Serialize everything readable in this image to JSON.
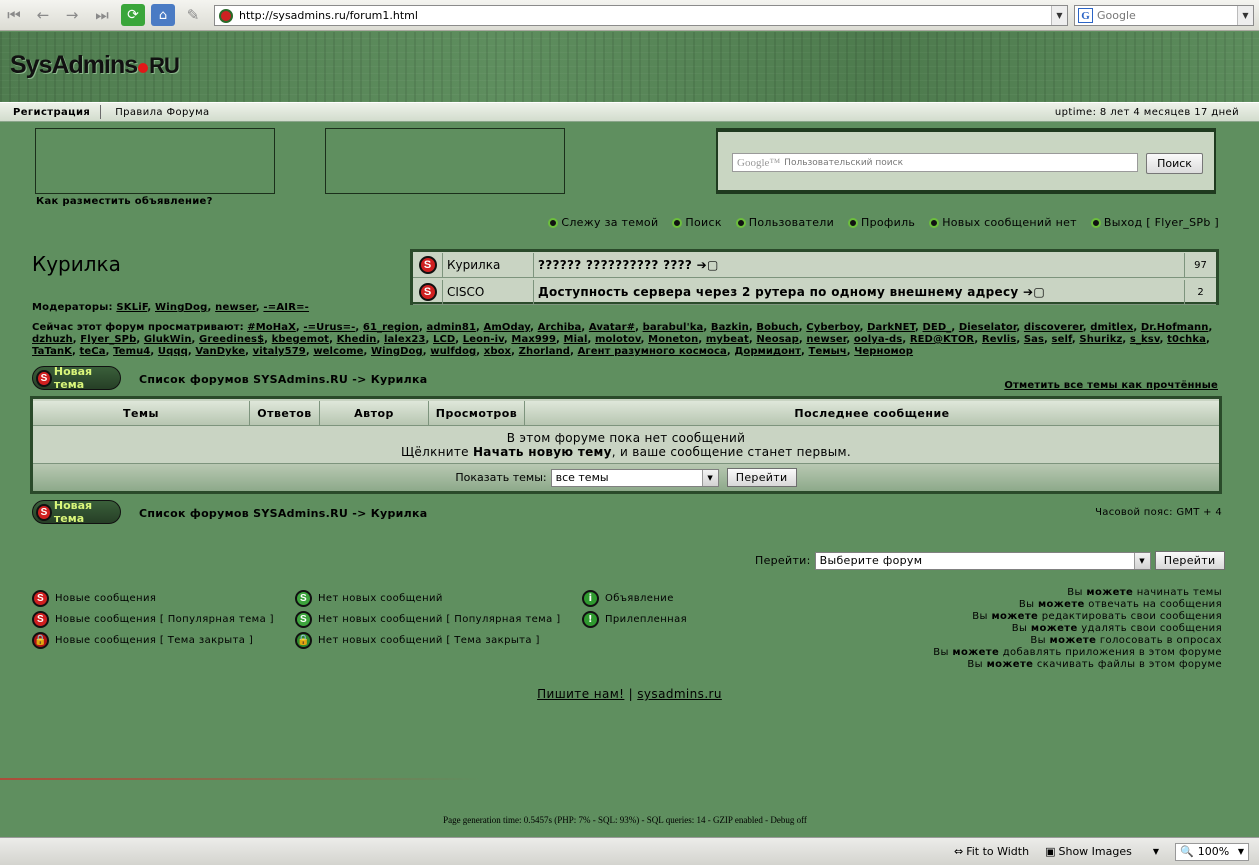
{
  "browser": {
    "url": "http://sysadmins.ru/forum1.html",
    "search_placeholder": "Google",
    "search_engine_letter": "G"
  },
  "header": {
    "logo_main": "SysAdmins",
    "logo_tld": "RU"
  },
  "nav": {
    "registration": "Регистрация",
    "rules": "Правила Форума",
    "uptime": "uptime: 8 лет 4 месяцев 17 дней"
  },
  "ads": {
    "how_to_place": "Как разместить объявление?"
  },
  "gsearch": {
    "brand": "Google™",
    "placeholder": "Пользовательский поиск",
    "button": "Поиск"
  },
  "topmenu": [
    {
      "label": "Слежу за темой"
    },
    {
      "label": "Поиск"
    },
    {
      "label": "Пользователи"
    },
    {
      "label": "Профиль"
    },
    {
      "label": "Новых сообщений нет"
    },
    {
      "label": "Выход [ Flyer_SPb ]"
    }
  ],
  "forum": {
    "title": "Курилка",
    "moderators_label": "Модераторы:",
    "moderators": [
      "SKLiF",
      "WingDog",
      "newser",
      "-=AIR=-"
    ],
    "viewers_label": "Сейчас этот форум просматривают:",
    "viewers": [
      "#MoHaX",
      "-=Urus=-",
      "61_region",
      "admin81",
      "AmOday",
      "Archiba",
      "Avatar#",
      "barabul'ka",
      "Bazkin",
      "Bobuch",
      "Cyberboy",
      "DarkNET",
      "DED_",
      "Dieselator",
      "discoverer",
      "dmitlex",
      "Dr.Hofmann",
      "dzhuzh",
      "Flyer_SPb",
      "GlukWin",
      "Greedines$",
      "kbegemot",
      "Khedin",
      "lalex23",
      "LCD",
      "Leon-iv",
      "Max999",
      "Mial",
      "molotov",
      "Moneton",
      "mybeat",
      "Neosap",
      "newser",
      "oolya-ds",
      "RED@KTOR",
      "Revlis",
      "Sas",
      "self",
      "Shurikz",
      "s_ksv",
      "t0chka",
      "TaTanK",
      "teCa",
      "Temu4",
      "Uqqq",
      "VanDyke",
      "vitaly579",
      "welcome",
      "WingDog",
      "wulfdog",
      "xbox",
      "Zhorland",
      "Агент разумного космоса",
      "Дормидонт",
      "Темыч",
      "Черномор"
    ]
  },
  "recent": [
    {
      "forum": "Курилка",
      "topic": "?????? ?????????? ???? ➔▢",
      "count": "97"
    },
    {
      "forum": "CISCO",
      "topic": "Доступность сервера через 2 рутера по одному внешнему адресу ➔▢",
      "count": "2"
    }
  ],
  "actions": {
    "new_topic": "Новая тема",
    "breadcrumb": "Список форумов SYSAdmins.RU -> Курилка",
    "mark_all": "Отметить все темы как прочтённые",
    "timezone": "Часовой пояс: GMT + 4"
  },
  "topics": {
    "headers": [
      "Темы",
      "Ответов",
      "Автор",
      "Просмотров",
      "Последнее сообщение"
    ],
    "empty_line1": "В этом форуме пока нет сообщений",
    "empty_pre": "Щёлкните ",
    "empty_bold": "Начать новую тему",
    "empty_post": ", и ваше сообщение станет первым.",
    "show_label": "Показать темы:",
    "show_value": "все темы",
    "go_button": "Перейти"
  },
  "jump": {
    "label": "Перейти:",
    "value": "Выберите форум",
    "button": "Перейти"
  },
  "legend": [
    {
      "label": "Новые сообщения"
    },
    {
      "label": "Новые сообщения [ Популярная тема ]"
    },
    {
      "label": "Новые сообщения [ Тема закрыта ]"
    },
    {
      "label": "Нет новых сообщений"
    },
    {
      "label": "Нет новых сообщений [ Популярная тема ]"
    },
    {
      "label": "Нет новых сообщений [ Тема закрыта ]"
    },
    {
      "label": "Объявление"
    },
    {
      "label": "Прилепленная"
    }
  ],
  "permissions": [
    {
      "pre": "Вы ",
      "can": "можете",
      "post": " начинать темы"
    },
    {
      "pre": "Вы ",
      "can": "можете",
      "post": " отвечать на сообщения"
    },
    {
      "pre": "Вы ",
      "can": "можете",
      "post": " редактировать свои сообщения"
    },
    {
      "pre": "Вы ",
      "can": "можете",
      "post": " удалять свои сообщения"
    },
    {
      "pre": "Вы ",
      "can": "можете",
      "post": " голосовать в опросах"
    },
    {
      "pre": "Вы ",
      "can": "можете",
      "post": " добавлять приложения в этом форуме"
    },
    {
      "pre": "Вы ",
      "can": "можете",
      "post": " скачивать файлы в этом форуме"
    }
  ],
  "footer": {
    "write_us": "Пишите нам!",
    "separator": "|",
    "site": "sysadmins.ru",
    "gen_time": "Page generation time: 0.5457s (PHP: 7% - SQL: 93%) - SQL queries: 14 - GZIP enabled - Debug off"
  },
  "statusbar": {
    "fit_width": "Fit to Width",
    "show_images": "Show Images",
    "zoom": "100%"
  }
}
